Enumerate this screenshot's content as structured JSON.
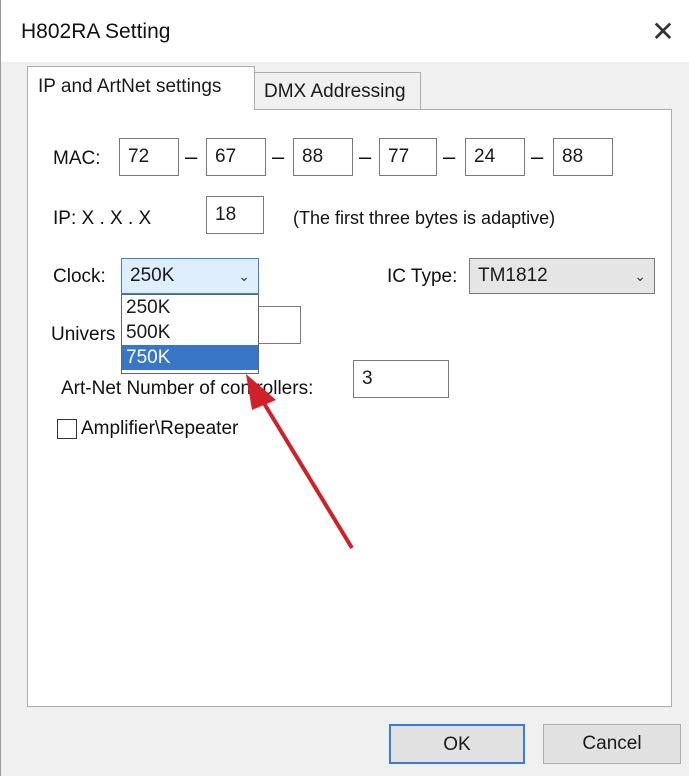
{
  "window": {
    "title": "H802RA Setting",
    "close_glyph": "✕"
  },
  "tabs": [
    {
      "label": "IP and ArtNet settings",
      "active": true
    },
    {
      "label": "DMX Addressing",
      "active": false
    }
  ],
  "mac": {
    "label": "MAC:",
    "octets": [
      "72",
      "67",
      "88",
      "77",
      "24",
      "88"
    ],
    "separator": "–"
  },
  "ip": {
    "label": "IP:  X  .  X  .  X",
    "value": "18",
    "note": "(The first three bytes  is adaptive)"
  },
  "clock": {
    "label": "Clock:",
    "selected": "250K",
    "options": [
      "250K",
      "500K",
      "750K"
    ],
    "highlighted": "750K"
  },
  "ic_type": {
    "label": "IC Type:",
    "selected": "TM1812"
  },
  "universe": {
    "label": "Univers"
  },
  "artnet": {
    "label": "Art-Net Number of controllers:",
    "value": "3"
  },
  "amplifier": {
    "label": "Amplifier\\Repeater",
    "checked": false
  },
  "buttons": {
    "ok": "OK",
    "cancel": "Cancel"
  },
  "colors": {
    "accent": "#3b7fd4",
    "highlight": "#3a76c8",
    "arrow": "#d0202a"
  }
}
